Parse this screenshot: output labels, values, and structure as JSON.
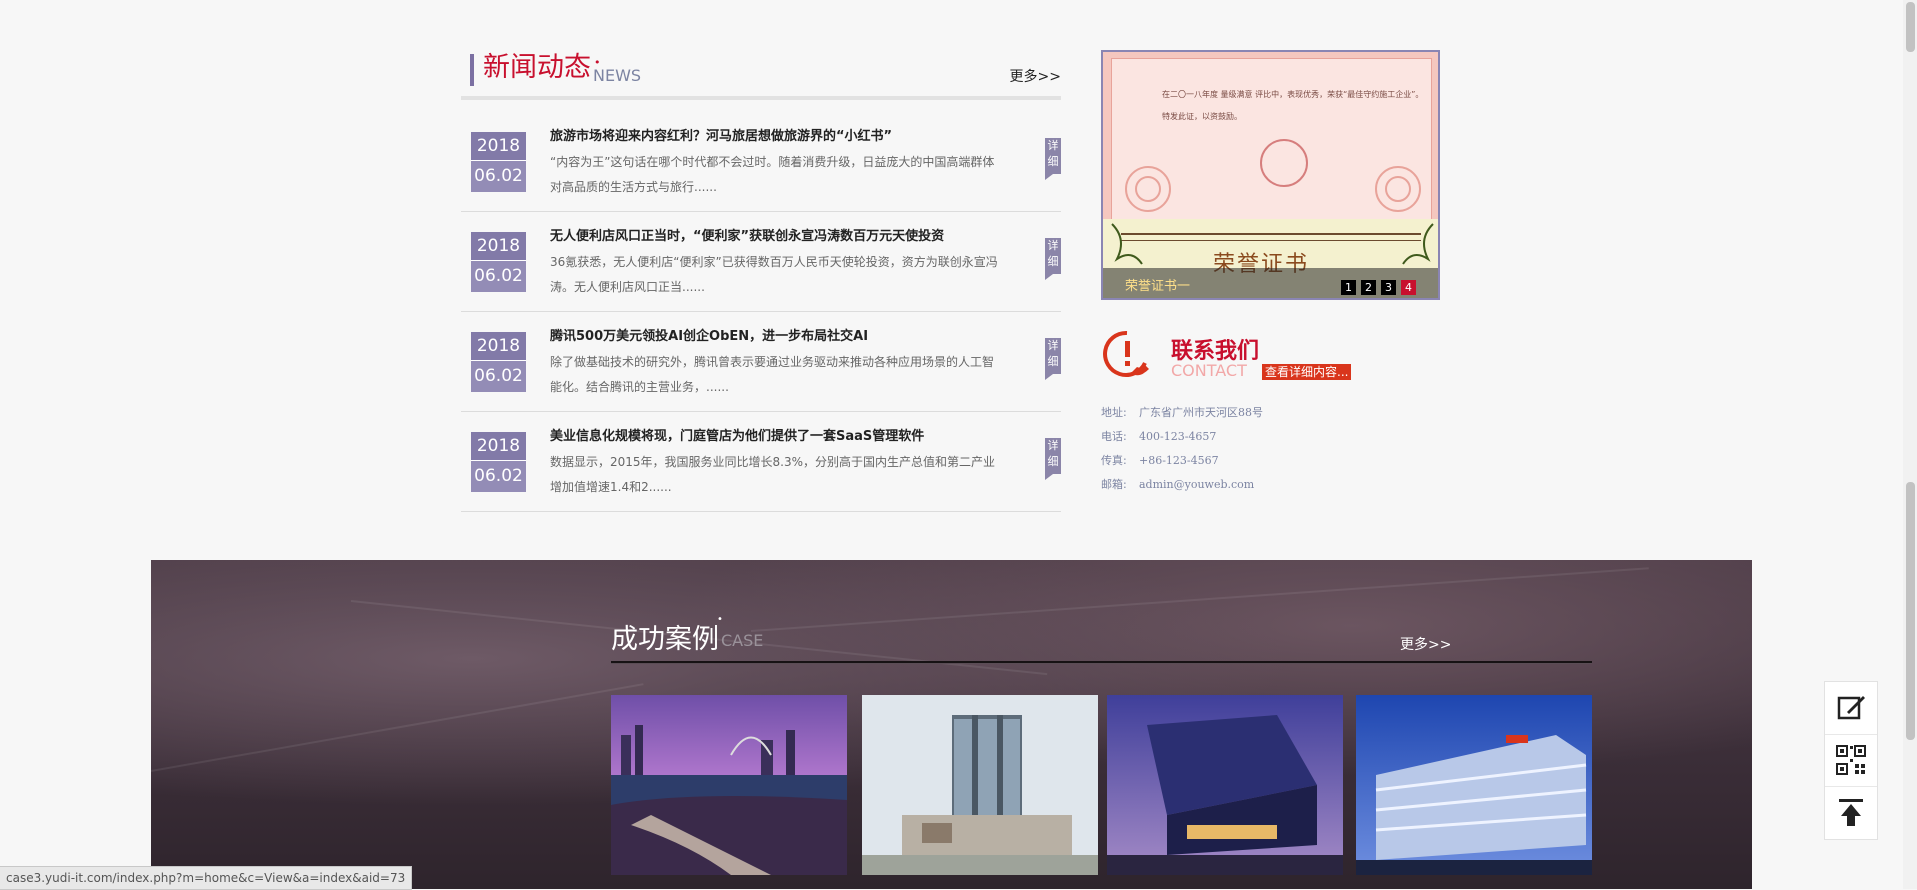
{
  "news": {
    "title": "新闻动态",
    "star": "•",
    "subtitle": "NEWS",
    "more": "更多>>",
    "detail_label": "详细",
    "items": [
      {
        "year": "2018",
        "date": "06.02",
        "title": "旅游市场将迎来内容红利？河马旅居想做旅游界的“小红书”",
        "desc": "“内容为王”这句话在哪个时代都不会过时。随着消费升级，日益庞大的中国高端群体对高品质的生活方式与旅行......"
      },
      {
        "year": "2018",
        "date": "06.02",
        "title": "无人便利店风口正当时，“便利家”获联创永宣冯涛数百万元天使投资",
        "desc": "36氪获悉，无人便利店“便利家”已获得数百万人民币天使轮投资，资方为联创永宣冯涛。无人便利店风口正当......"
      },
      {
        "year": "2018",
        "date": "06.02",
        "title": "腾讯500万美元领投AI创企ObEN，进一步布局社交AI",
        "desc": "除了做基础技术的研究外，腾讯曾表示要通过业务驱动来推动各种应用场景的人工智能化。结合腾讯的主营业务，......"
      },
      {
        "year": "2018",
        "date": "06.02",
        "title": "美业信息化规模将现，门庭管店为他们提供了一套SaaS管理软件",
        "desc": "数据显示，2015年，我国服务业同比增长8.3%，分别高于国内生产总值和第二产业增加值增速1.4和2......"
      }
    ]
  },
  "certificate": {
    "line1": "在二〇一八年度  量级满意  评比中，表现优秀，荣获“最佳守约施工企业”。",
    "line2": "特发此证，以资鼓励。",
    "big_text": "荣誉证书",
    "caption": "荣誉证书一",
    "dots": [
      "1",
      "2",
      "3",
      "4"
    ],
    "active_dot": 3
  },
  "contact": {
    "title": "联系我们",
    "subtitle": "CONTACT",
    "link": "查看详细内容...",
    "rows": [
      {
        "label": "地址:",
        "value": "广东省广州市天河区88号"
      },
      {
        "label": "电话:",
        "value": "400-123-4657"
      },
      {
        "label": "传真:",
        "value": "+86-123-4567"
      },
      {
        "label": "邮箱:",
        "value": "admin@youweb.com"
      }
    ]
  },
  "cases": {
    "title": "成功案例",
    "star": "•",
    "subtitle": "CASE",
    "more": "更多>>",
    "images": [
      "case-photo-riverside-city",
      "case-photo-office-tower",
      "case-photo-glass-building",
      "case-photo-blue-office"
    ]
  },
  "status_url": "case3.yudi-it.com/index.php?m=home&c=View&a=index&aid=73",
  "sidetools": [
    "edit-icon",
    "qrcode-icon",
    "back-to-top-icon"
  ],
  "colors": {
    "brand_red": "#c8102e",
    "accent_purple": "#938cb6",
    "contact_red": "#d9351c"
  }
}
